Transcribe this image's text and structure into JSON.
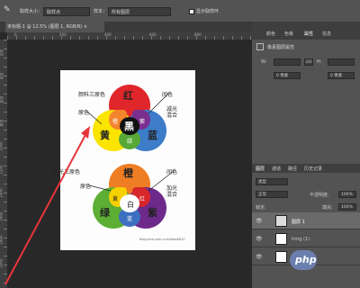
{
  "options": {
    "mode_label": "取样大小：",
    "mode_value": "取样点",
    "sample_label": "样本：",
    "sample_value": "所有图层",
    "show_ring_label": "显示取样环"
  },
  "document_tab": "未标题-1 @ 12.5% (图层 1, RGB/8) ×",
  "ruler": {
    "left_numbers": [
      "200",
      "400",
      "600",
      "800",
      "1000",
      "1200",
      "1400",
      "1600",
      "1800",
      "2000"
    ],
    "top_numbers": [
      "0",
      "200",
      "400",
      "600",
      "800"
    ]
  },
  "diagram": {
    "top_title": "颜料三原色",
    "top_left_label": "原色",
    "top_right_label": "间色",
    "top_right_label2": "减光混合",
    "top_red": "红",
    "top_yellow": "黄",
    "top_blue": "蓝",
    "top_black": "黑",
    "top_orange": "橙",
    "top_green": "绿",
    "top_purple": "紫",
    "bottom_title": "色光三原色",
    "bottom_left_label": "原色",
    "bottom_right_label": "间色",
    "bottom_right_label2": "加光混合",
    "bottom_orange": "橙",
    "bottom_green": "绿",
    "bottom_purple": "紫",
    "bottom_yellow": "黄",
    "bottom_white": "白",
    "bottom_red": "红",
    "bottom_blue": "蓝",
    "credit": "blog.sina.com.cn/shitao6810"
  },
  "panel": {
    "tabs": [
      "颜色",
      "色板",
      "属性",
      "信息"
    ],
    "properties_title": "像素图层属性",
    "w_label": "W:",
    "w_value": "0 像素",
    "h_label": "H:",
    "h_value": "0 像素",
    "link": "GO",
    "x_label": "X:",
    "y_label": "Y:",
    "layers_tabs": [
      "图层",
      "通道",
      "路径",
      "历史记录"
    ],
    "kind": "类型",
    "blend": "正常",
    "opacity_label": "不透明度:",
    "opacity_value": "100%",
    "lock_label": "锁定:",
    "fill_label": "填充:",
    "fill_value": "100%",
    "layers": [
      {
        "name": "图层 1"
      },
      {
        "name": "timg (1)"
      },
      {
        "name": "背景"
      }
    ]
  },
  "watermark": "php",
  "colors": {
    "accent": "#e8353a",
    "bg": "#282828",
    "panel": "#535353"
  }
}
